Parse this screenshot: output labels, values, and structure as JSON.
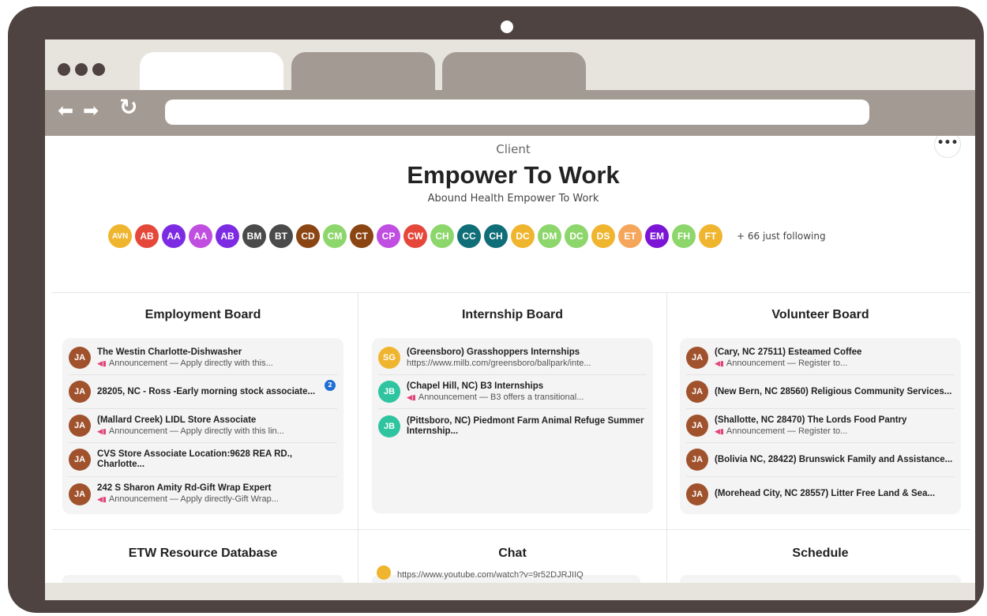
{
  "browser": {
    "tabs": [
      "",
      "",
      ""
    ],
    "url": ""
  },
  "header": {
    "client_label": "Client",
    "title": "Empower To Work",
    "subtitle": "Abound Health Empower To Work",
    "more_label": "•••"
  },
  "members": [
    {
      "initials": "AVN",
      "color": "#f0b52f"
    },
    {
      "initials": "AB",
      "color": "#e5483b"
    },
    {
      "initials": "AA",
      "color": "#7c2be3"
    },
    {
      "initials": "AA",
      "color": "#c04ee0"
    },
    {
      "initials": "AB",
      "color": "#7c2be3"
    },
    {
      "initials": "BM",
      "color": "#4a4a4a"
    },
    {
      "initials": "BT",
      "color": "#4a4a4a"
    },
    {
      "initials": "CD",
      "color": "#8b4513"
    },
    {
      "initials": "CM",
      "color": "#8cd66b"
    },
    {
      "initials": "CT",
      "color": "#8b4513"
    },
    {
      "initials": "CP",
      "color": "#c04ee0"
    },
    {
      "initials": "CW",
      "color": "#e5483b"
    },
    {
      "initials": "CH",
      "color": "#8cd66b"
    },
    {
      "initials": "CC",
      "color": "#0f6e77"
    },
    {
      "initials": "CH",
      "color": "#0f6e77"
    },
    {
      "initials": "DC",
      "color": "#f0b52f"
    },
    {
      "initials": "DM",
      "color": "#8cd66b"
    },
    {
      "initials": "DC",
      "color": "#8cd66b"
    },
    {
      "initials": "DS",
      "color": "#f0b52f"
    },
    {
      "initials": "ET",
      "color": "#f5a65b"
    },
    {
      "initials": "EM",
      "color": "#7c14d6"
    },
    {
      "initials": "FH",
      "color": "#8cd66b"
    },
    {
      "initials": "FT",
      "color": "#f0b52f"
    }
  ],
  "following_text": "+ 66 just following",
  "boards": [
    {
      "title": "Employment Board",
      "items": [
        {
          "initials": "JA",
          "color": "#a0522d",
          "title": "The Westin Charlotte-Dishwasher",
          "sub": "Announcement — Apply directly with this...",
          "announce": true
        },
        {
          "initials": "JA",
          "color": "#a0522d",
          "title": "28205, NC - Ross -Early morning stock associate...",
          "sub": "",
          "announce": false,
          "badge": "2"
        },
        {
          "initials": "JA",
          "color": "#a0522d",
          "title": "(Mallard Creek) LIDL Store Associate",
          "sub": "Announcement — Apply directly with this lin...",
          "announce": true
        },
        {
          "initials": "JA",
          "color": "#a0522d",
          "title": "CVS Store Associate Location:9628 REA RD., Charlotte...",
          "sub": "",
          "announce": false
        },
        {
          "initials": "JA",
          "color": "#a0522d",
          "title": "242 S Sharon Amity Rd-Gift Wrap Expert",
          "sub": "Announcement — Apply directly-Gift Wrap...",
          "announce": true
        }
      ]
    },
    {
      "title": "Internship Board",
      "items": [
        {
          "initials": "SG",
          "color": "#f0b52f",
          "title": "(Greensboro) Grasshoppers Internships",
          "sub": "https://www.milb.com/greensboro/ballpark/inte...",
          "announce": false
        },
        {
          "initials": "JB",
          "color": "#2ec4a0",
          "title": "(Chapel Hill, NC) B3 Internships",
          "sub": "Announcement — B3 offers a transitional...",
          "announce": true
        },
        {
          "initials": "JB",
          "color": "#2ec4a0",
          "title": "(Pittsboro, NC) Piedmont Farm Animal Refuge Summer Internship...",
          "sub": "",
          "announce": false
        }
      ]
    },
    {
      "title": "Volunteer Board",
      "items": [
        {
          "initials": "JA",
          "color": "#a0522d",
          "title": "(Cary, NC 27511) Esteamed Coffee",
          "sub": "Announcement — Register to...",
          "announce": true
        },
        {
          "initials": "JA",
          "color": "#a0522d",
          "title": "(New Bern, NC 28560) Religious Community Services...",
          "sub": "",
          "announce": false
        },
        {
          "initials": "JA",
          "color": "#a0522d",
          "title": "(Shallotte, NC 28470) The Lords Food Pantry",
          "sub": "Announcement — Register to...",
          "announce": true
        },
        {
          "initials": "JA",
          "color": "#a0522d",
          "title": "(Bolivia NC, 28422) Brunswick Family and Assistance...",
          "sub": "",
          "announce": false
        },
        {
          "initials": "JA",
          "color": "#a0522d",
          "title": "(Morehead City, NC 28557) Litter Free Land & Sea...",
          "sub": "",
          "announce": false
        }
      ]
    }
  ],
  "sections": {
    "resource_db": "ETW Resource Database",
    "chat": "Chat",
    "schedule": "Schedule",
    "chat_preview": "https://www.youtube.com/watch?v=9r52DJRJIIQ"
  }
}
